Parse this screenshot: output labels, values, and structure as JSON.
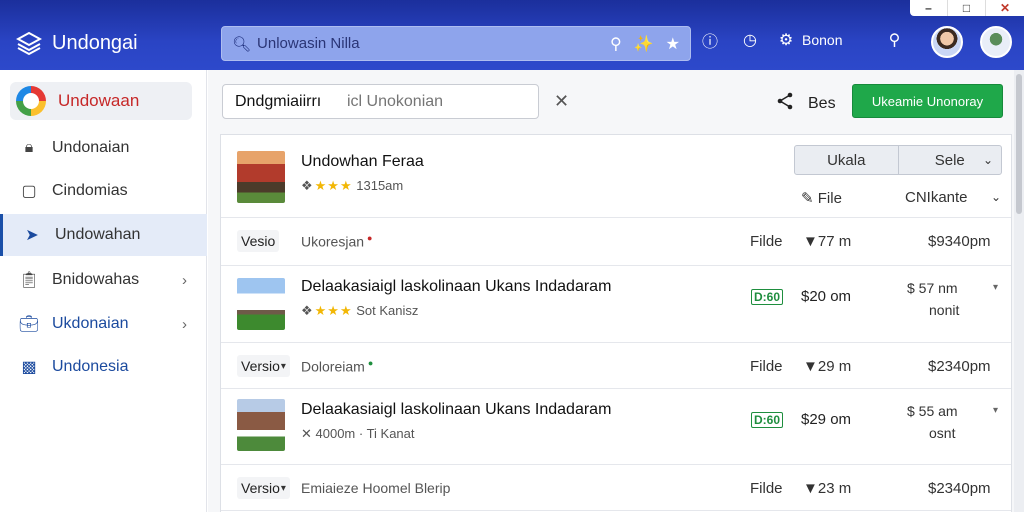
{
  "app": {
    "name": "Undongai",
    "window_controls": {
      "minimize": "–",
      "maximize": "□",
      "close": "✕"
    }
  },
  "header": {
    "search_placeholder": "Unlowasin Nilla",
    "user_label": "Bonon",
    "icons": [
      "search-icon",
      "wand-icon",
      "star-icon",
      "help-icon",
      "clock-icon",
      "gear-icon",
      "zoom-icon"
    ]
  },
  "sidebar": {
    "top": {
      "label": "Undowaan"
    },
    "items": [
      {
        "label": "Undonaian",
        "icon": "lock-icon",
        "chevron": false
      },
      {
        "label": "Cindomias",
        "icon": "square-icon",
        "chevron": false
      },
      {
        "label": "Undowahan",
        "icon": "megaphone-icon",
        "chevron": false,
        "active": true
      },
      {
        "label": "Bnidowahas",
        "icon": "clipboard-icon",
        "chevron": true
      },
      {
        "label": "Ukdonaian",
        "icon": "bag-icon",
        "chevron": true
      },
      {
        "label": "Undonesia",
        "icon": "chart-icon",
        "chevron": false
      }
    ]
  },
  "toolbar": {
    "filter_value": "Dndgmiaiirrı",
    "filter_placeholder": "icl Unokonian",
    "share_label": "Bes",
    "primary_button": "Ukeamie Unonoray"
  },
  "listing": {
    "header_row": {
      "title": "Undowhan Feraa",
      "rating_text": "1315am",
      "segment_left": "Ukala",
      "segment_right": "Sele",
      "file_label": "File",
      "sort_label": "CNIkante"
    },
    "rows": [
      {
        "type": "compact",
        "tag": "Vesio",
        "text": "Ukoresjan",
        "dot": "red",
        "file": "Filde",
        "value": "▼77 m",
        "price": "$9340pm"
      },
      {
        "type": "rich",
        "title": "Delaakasiaigl laskolinaan Ukans Indadaram",
        "rating_text": "Sot Kanisz",
        "badge": "D:60",
        "price": "$20 om",
        "right1": "$ 57 nm",
        "right2": "nonit"
      },
      {
        "type": "compact",
        "tag": "Versio",
        "text": "Doloreiam",
        "dot": "green",
        "file": "Filde",
        "value": "▼29 m",
        "price": "$2340pm"
      },
      {
        "type": "rich",
        "title": "Delaakasiaigl laskolinaan Ukans Indadaram",
        "rating_text": "✕ 4000m · Ti Kanat",
        "badge": "D:60",
        "price": "$29 om",
        "right1": "$ 55 am",
        "right2": "osnt"
      },
      {
        "type": "compact",
        "tag": "Versio",
        "text": "Emiaieze Hoomel Blerip",
        "dot": "",
        "file": "Filde",
        "value": "▼23 m",
        "price": "$2340pm"
      }
    ]
  },
  "colors": {
    "header": "#2a44c4",
    "primary_button": "#1fa84a",
    "accent_red": "#c62828",
    "active_bar": "#1a4fa8"
  }
}
